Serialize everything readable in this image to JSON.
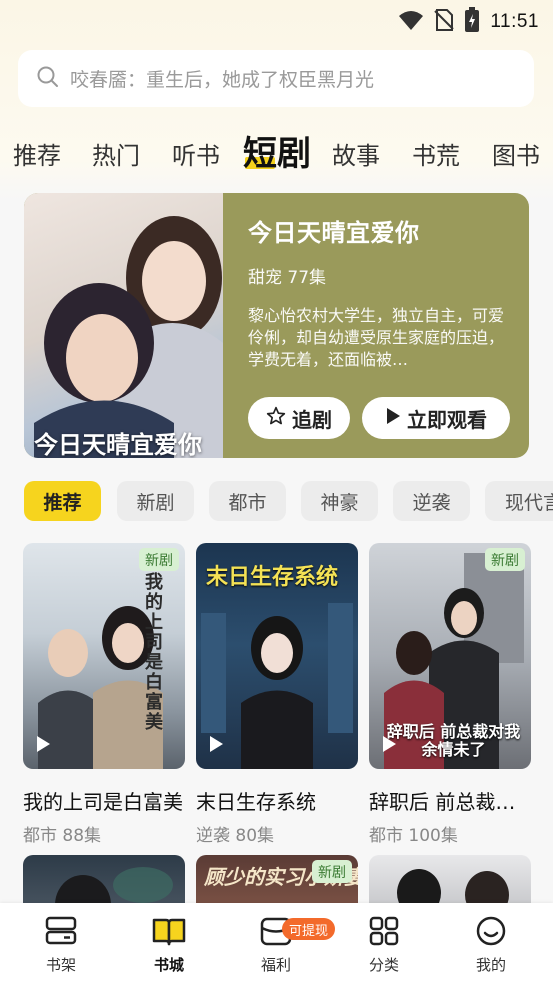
{
  "status": {
    "time": "11:51"
  },
  "search": {
    "placeholder": "咬春靥：重生后，她成了权臣黑月光"
  },
  "top_tabs": [
    {
      "label": "推荐",
      "active": false
    },
    {
      "label": "热门",
      "active": false
    },
    {
      "label": "听书",
      "active": false
    },
    {
      "label": "短剧",
      "active": true
    },
    {
      "label": "故事",
      "active": false
    },
    {
      "label": "书荒",
      "active": false
    },
    {
      "label": "图书",
      "active": false
    }
  ],
  "featured": {
    "title": "今日天晴宜爱你",
    "meta": "甜宠 77集",
    "description": "黎心怡农村大学生，独立自主，可爱伶俐，却自幼遭受原生家庭的压迫，学费无着，还面临被…",
    "cover_text": "今日天晴宜爱你",
    "follow_label": "追剧",
    "watch_label": "立即观看",
    "bg_color": "#9a9a5b"
  },
  "chips": [
    {
      "label": "推荐",
      "active": true
    },
    {
      "label": "新剧",
      "active": false
    },
    {
      "label": "都市",
      "active": false
    },
    {
      "label": "神豪",
      "active": false
    },
    {
      "label": "逆袭",
      "active": false
    },
    {
      "label": "现代言情",
      "active": false
    }
  ],
  "dramas": [
    {
      "title": "我的上司是白富美",
      "meta": "都市 88集",
      "badge": "新剧",
      "cover_text": "我的上司是白富美"
    },
    {
      "title": "末日生存系统",
      "meta": "逆袭 80集",
      "badge": "",
      "cover_text": "末日生存系统"
    },
    {
      "title": "辞职后 前总裁对我余情未了",
      "meta": "都市 100集",
      "badge": "新剧",
      "cover_text": "辞职后 前总裁对我余情未了"
    }
  ],
  "dramas_row2": [
    {
      "badge": "",
      "cover_text": ""
    },
    {
      "badge": "新剧",
      "cover_text": "顾少的实习小娇妻"
    },
    {
      "badge": "",
      "cover_text": ""
    }
  ],
  "bottom_nav": [
    {
      "label": "书架",
      "icon": "bookshelf-icon",
      "active": false
    },
    {
      "label": "书城",
      "icon": "book-open-icon",
      "active": true
    },
    {
      "label": "福利",
      "icon": "gift-box-icon",
      "active": false,
      "badge": "可提现"
    },
    {
      "label": "分类",
      "icon": "category-grid-icon",
      "active": false
    },
    {
      "label": "我的",
      "icon": "profile-smile-icon",
      "active": false
    }
  ],
  "colors": {
    "accent": "#f6d41e",
    "badge_orange": "#f36a2b",
    "new_badge_bg": "#d8f0d2"
  }
}
